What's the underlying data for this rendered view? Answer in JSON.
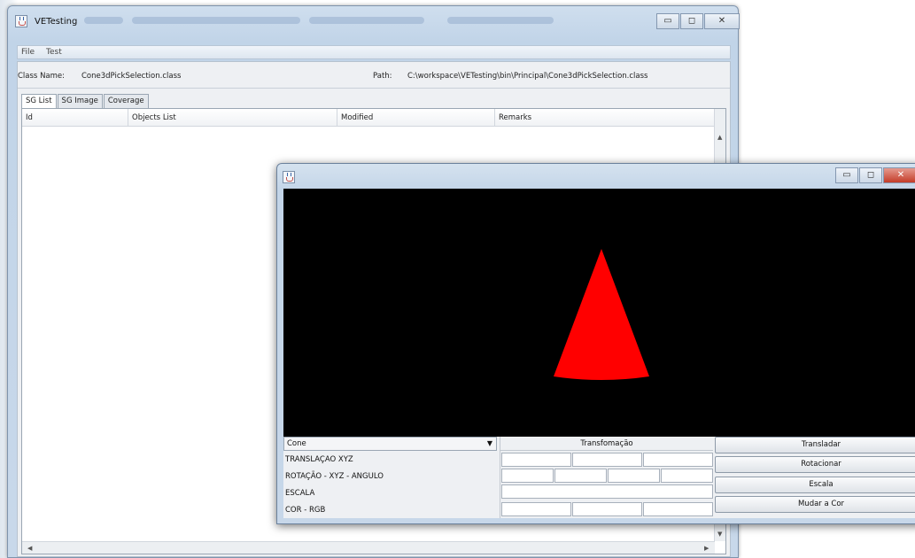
{
  "main_window": {
    "title": "VETesting",
    "menu": [
      "File",
      "Test"
    ],
    "class_name_label": "Class Name:",
    "class_name_value": "Cone3dPickSelection.class",
    "path_label": "Path:",
    "path_value": "C:\\workspace\\VETesting\\bin\\Principal\\Cone3dPickSelection.class",
    "tabs": [
      "SG List",
      "SG Image",
      "Coverage"
    ],
    "active_tab": "SG List",
    "table_columns": [
      "Id",
      "Objects List",
      "Modified",
      "Remarks"
    ]
  },
  "popup_window": {
    "shape_select": {
      "selected": "Cone"
    },
    "transform_header": "Transfomação",
    "row_labels": [
      "TRANSLAÇAO XYZ",
      "ROTAÇÃO - XYZ - ANGULO",
      "ESCALA",
      "COR - RGB"
    ],
    "buttons": [
      "Transladar",
      "Rotacionar",
      "Escala",
      "Mudar a Cor"
    ],
    "cone_color": "#ff0000",
    "canvas_background": "#000000"
  },
  "icons": [
    "java-app-icon",
    "minimize-icon",
    "maximize-icon",
    "close-icon",
    "chevron-down-icon",
    "scroll-up-arrow-icon",
    "scroll-down-arrow-icon",
    "scroll-left-arrow-icon",
    "scroll-right-arrow-icon"
  ]
}
